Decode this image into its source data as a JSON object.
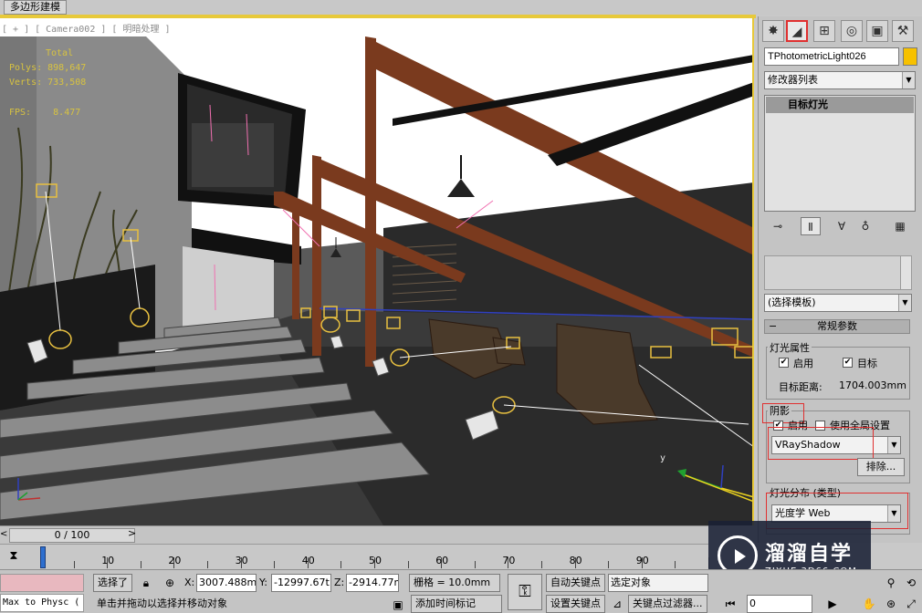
{
  "window": {
    "title_tab": "多边形建模"
  },
  "viewport": {
    "label": "[ + ] [ Camera002 ] [ 明暗处理 ]",
    "stats": {
      "total_label": "Total",
      "polys": "Polys: 898,647",
      "verts": "Verts: 733,508",
      "fps": "FPS:    8.477"
    },
    "axis_y": "y"
  },
  "panel": {
    "tabs": [
      "create-icon",
      "modify-icon",
      "hierarchy-icon",
      "motion-icon",
      "display-icon",
      "utilities-icon"
    ],
    "object_name": "TPhotometricLight026",
    "object_color": "#f7c100",
    "modifier_list": "修改器列表",
    "stack_item": "目标灯光",
    "template_dropdown": "(选择模板)",
    "general_params": "常规参数",
    "light_props": {
      "title": "灯光属性",
      "enable": "启用",
      "target": "目标",
      "target_distance_label": "目标距离:",
      "target_distance": "1704.003mm"
    },
    "shadow": {
      "title": "阴影",
      "enable": "启用",
      "use_global": "使用全局设置",
      "type": "VRayShadow",
      "exclude": "排除..."
    },
    "distribution": {
      "title": "灯光分布 (类型)",
      "value": "光度学 Web"
    },
    "peek_text": "eb)"
  },
  "timeline": {
    "slider": "0 / 100",
    "ticks": [
      "0",
      "10",
      "20",
      "30",
      "40",
      "50",
      "60",
      "70",
      "80",
      "90",
      "100"
    ]
  },
  "status": {
    "maxscript": "Max to Physc (",
    "selected": "选择了",
    "x_label": "X:",
    "x_value": "3007.488m",
    "y_label": "Y:",
    "y_value": "-12997.67t",
    "z_label": "Z:",
    "z_value": "-2914.77m",
    "grid": "栅格 = 10.0mm",
    "auto_key": "自动关键点",
    "set_key": "设置关键点",
    "selection_set": "选定对象",
    "key_filters": "关键点过滤器...",
    "prompt": "单击并拖动以选择并移动对象",
    "add_time_tag": "添加时间标记",
    "frame": "0"
  },
  "watermark": {
    "title": "溜溜自学",
    "url": "ZIXUE.3D66.COM"
  }
}
